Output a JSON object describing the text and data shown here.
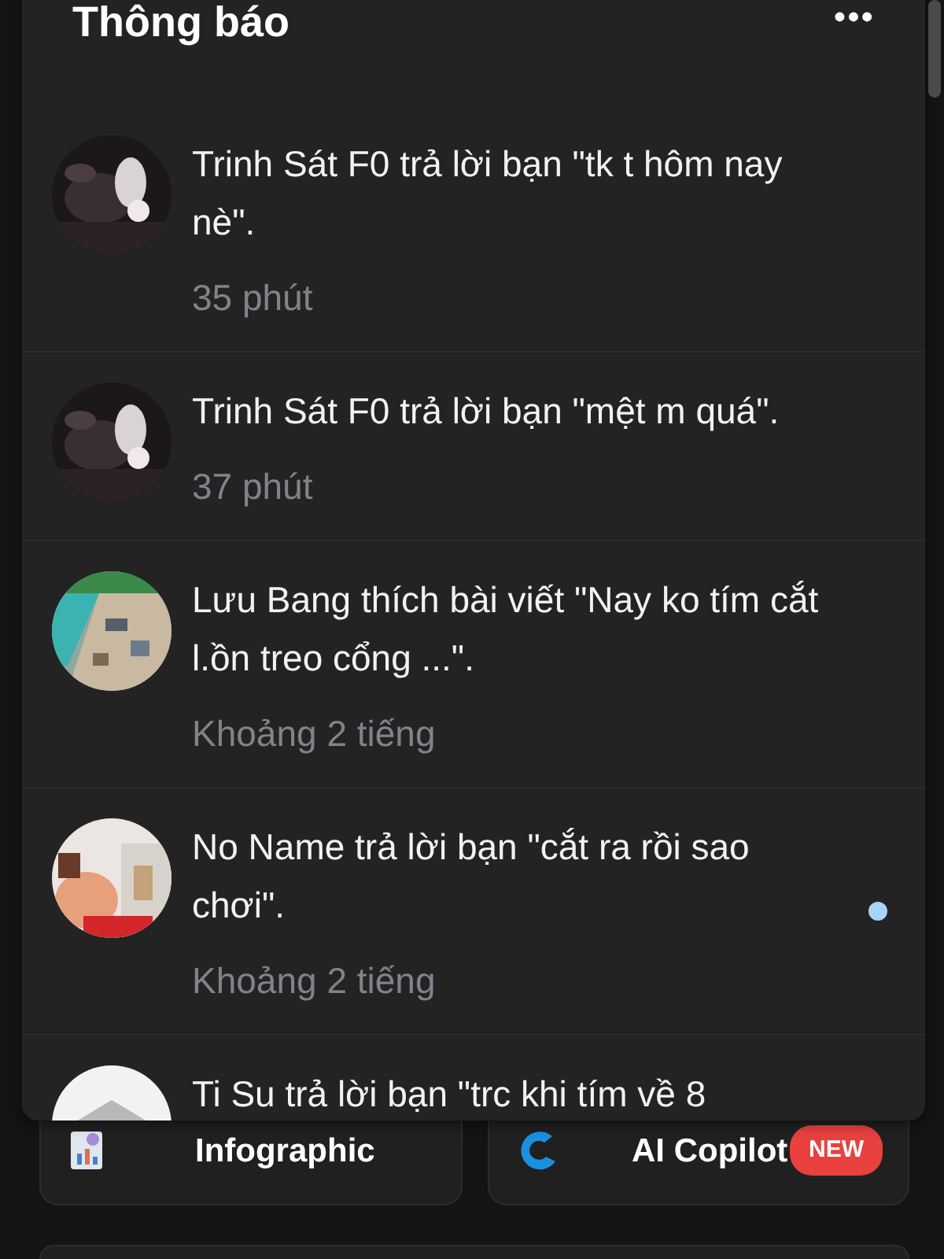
{
  "panel": {
    "title": "Thông báo",
    "menu": "•••"
  },
  "notifications": [
    {
      "text": "Trinh Sát F0 trả lời bạn \"tk t hôm nay nè\".",
      "time": "35 phút",
      "unread": false
    },
    {
      "text": "Trinh Sát F0 trả lời bạn \"mệt m quá\".",
      "time": "37 phút",
      "unread": false
    },
    {
      "text": "Lưu Bang thích bài viết \"Nay ko tím cắt l.ồn treo cổng ...\".",
      "time": "Khoảng 2 tiếng",
      "unread": false
    },
    {
      "text": "No Name trả lời bạn \"cắt ra rồi sao chơi\".",
      "time": "Khoảng 2 tiếng",
      "unread": true
    },
    {
      "text": "Ti Su trả lời bạn \"trc khi tím về 8"
    }
  ],
  "tools": [
    {
      "label": "Infographic",
      "kind": "infographic"
    },
    {
      "label": "AI Copilot",
      "kind": "copilot",
      "badge": "NEW"
    }
  ]
}
